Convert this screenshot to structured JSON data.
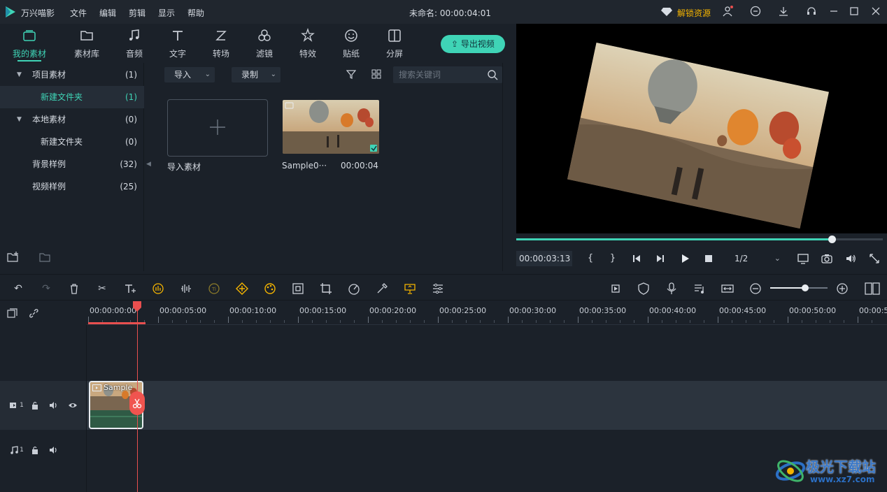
{
  "app": {
    "name": "万兴喵影",
    "menu": [
      "文件",
      "编辑",
      "剪辑",
      "显示",
      "帮助"
    ],
    "title": "未命名: 00:00:04:01",
    "unlock": "解锁资源"
  },
  "tabs": [
    {
      "label": "我的素材",
      "icon": "my-media-icon",
      "active": true
    },
    {
      "label": "素材库",
      "icon": "folder-icon"
    },
    {
      "label": "音频",
      "icon": "music-note-icon"
    },
    {
      "label": "文字",
      "icon": "text-icon"
    },
    {
      "label": "转场",
      "icon": "transition-icon"
    },
    {
      "label": "滤镜",
      "icon": "filter-icon"
    },
    {
      "label": "特效",
      "icon": "effects-icon"
    },
    {
      "label": "贴纸",
      "icon": "sticker-icon"
    },
    {
      "label": "分屏",
      "icon": "split-screen-icon"
    }
  ],
  "export_label": "导出视频",
  "tree": [
    {
      "label": "项目素材",
      "count": "(1)",
      "expandable": true
    },
    {
      "label": "新建文件夹",
      "count": "(1)",
      "selected": true
    },
    {
      "label": "本地素材",
      "count": "(0)",
      "expandable": true
    },
    {
      "label": "新建文件夹",
      "count": "(0)"
    },
    {
      "label": "背景样例",
      "count": "(32)"
    },
    {
      "label": "视频样例",
      "count": "(25)"
    }
  ],
  "media_toolbar": {
    "import_label": "导入",
    "record_label": "录制",
    "search_placeholder": "搜索关键词"
  },
  "media": {
    "import_label": "导入素材",
    "clip_name": "Sample0···",
    "clip_duration": "00:00:04"
  },
  "preview": {
    "progress": 0.86,
    "timecode": "00:00:03:13",
    "ratio": "1/2"
  },
  "timeline": {
    "ruler_labels": [
      "00:00:00:00",
      "00:00:05:00",
      "00:00:10:00",
      "00:00:15:00",
      "00:00:20:00",
      "00:00:25:00",
      "00:00:30:00",
      "00:00:35:00",
      "00:00:40:00",
      "00:00:45:00",
      "00:00:50:00",
      "00:00:5"
    ],
    "video_track": "1",
    "audio_track": "1",
    "clip_label": "Sample"
  },
  "watermark": {
    "title": "极光下载站",
    "url": "www.xz7.com"
  },
  "colors": {
    "accent": "#3fd4b6",
    "playhead": "#e84f4f",
    "toolbar_highlight": "#f4b400"
  }
}
